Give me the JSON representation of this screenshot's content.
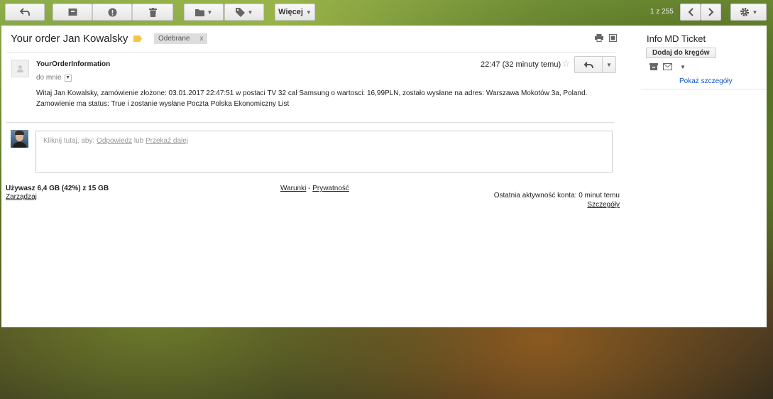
{
  "toolbar": {
    "more_label": "Więcej",
    "pager_text": "1 z 255",
    "icons": [
      "back-arrow-icon",
      "archive-icon",
      "spam-icon",
      "trash-icon",
      "folder-icon",
      "label-icon",
      "chevron-left-icon",
      "chevron-right-icon",
      "gear-icon"
    ]
  },
  "email": {
    "subject": "Your order Jan Kowalsky",
    "folder_chip": "Odebrane",
    "folder_chip_close": "x",
    "sender": "YourOrderInformation",
    "to": "do mnie",
    "time": "22:47 (32 minuty temu)",
    "star": "☆",
    "body": "Witaj Jan Kowalsky, zamówienie złożone: 03.01.2017 22:47:51 w postaci TV 32 cal Samsung o wartosci: 16,99PLN, zostało wysłane na adres: Warszawa Mokotów 3a, Poland. Zamowienie ma status: True i zostanie wysłane Poczta Polska Ekonomiczny List"
  },
  "reply_box": {
    "prefix": "Kliknij tutaj, aby: ",
    "reply_link": "Odpowiedz",
    "or": " lub ",
    "forward_link": "Przekaż dalej"
  },
  "footer": {
    "storage": "Używasz 6,4 GB (42%) z 15 GB",
    "manage": "Zarządzaj",
    "terms": "Warunki",
    "sep": " - ",
    "privacy": "Prywatność",
    "last_activity": "Ostatnia aktywność konta: 0 minut temu",
    "details": "Szczegóły"
  },
  "sidebar": {
    "name": "Info MD Ticket",
    "add_circles": "Dodaj do kręgów",
    "show_details": "Pokaż szczegóły"
  },
  "colors": {
    "label_tag": "#f5c646",
    "link": "#1155cc"
  }
}
